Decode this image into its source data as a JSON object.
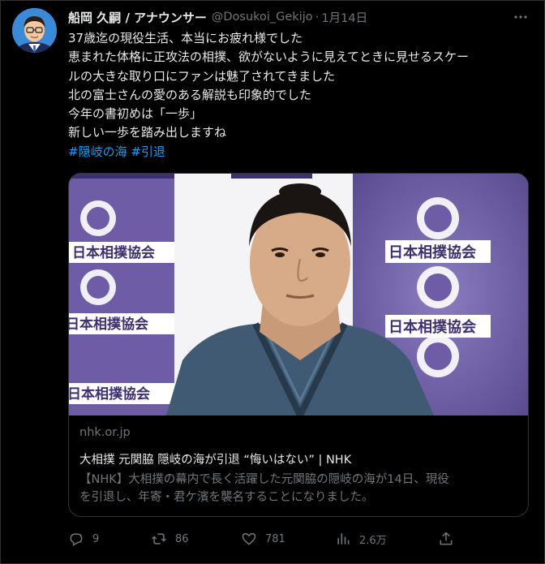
{
  "tweet": {
    "author_name": "船岡 久嗣 / アナウンサー",
    "handle": "@Dosukoi_Gekijo",
    "separator": "·",
    "date": "1月14日",
    "more_label": "···",
    "lines": [
      "37歳迄の現役生活、本当にお疲れ様でした",
      "恵まれた体格に正攻法の相撲、欲がないように見えてときに見せるスケー",
      "ルの大きな取り口にファンは魅了されてきました",
      "北の富士さんの愛のある解説も印象的でした",
      "今年の書初めは「一歩」",
      "新しい一歩を踏み出しますね"
    ],
    "hashtags": "#隠岐の海 #引退"
  },
  "card": {
    "domain": "nhk.or.jp",
    "title": "大相撲 元関脇 隠岐の海が引退 “悔いはない” | NHK",
    "description_line1": "【NHK】大相撲の幕内で長く活躍した元関脇の隠岐の海が14日、現役",
    "description_line2": "を引退し、年寄・君ケ濱を襲名することになりました。",
    "backdrop_text_left_top": "日本相撲協会",
    "backdrop_text_left_bottom": "日本相撲協会",
    "backdrop_text_right_top": "日本相撲協会",
    "backdrop_text_right_bottom": "日本相撲協会"
  },
  "actions": {
    "reply_count": "9",
    "retweet_count": "86",
    "like_count": "781",
    "view_count": "2.6万"
  },
  "colors": {
    "background": "#000000",
    "text": "#e7e9ea",
    "muted": "#71767b",
    "link": "#1d9bf0",
    "border": "#2f3336",
    "backdrop_purple": "#6b5aa0"
  },
  "icons": [
    "more-icon",
    "reply-icon",
    "retweet-icon",
    "like-icon",
    "views-icon",
    "share-icon"
  ]
}
